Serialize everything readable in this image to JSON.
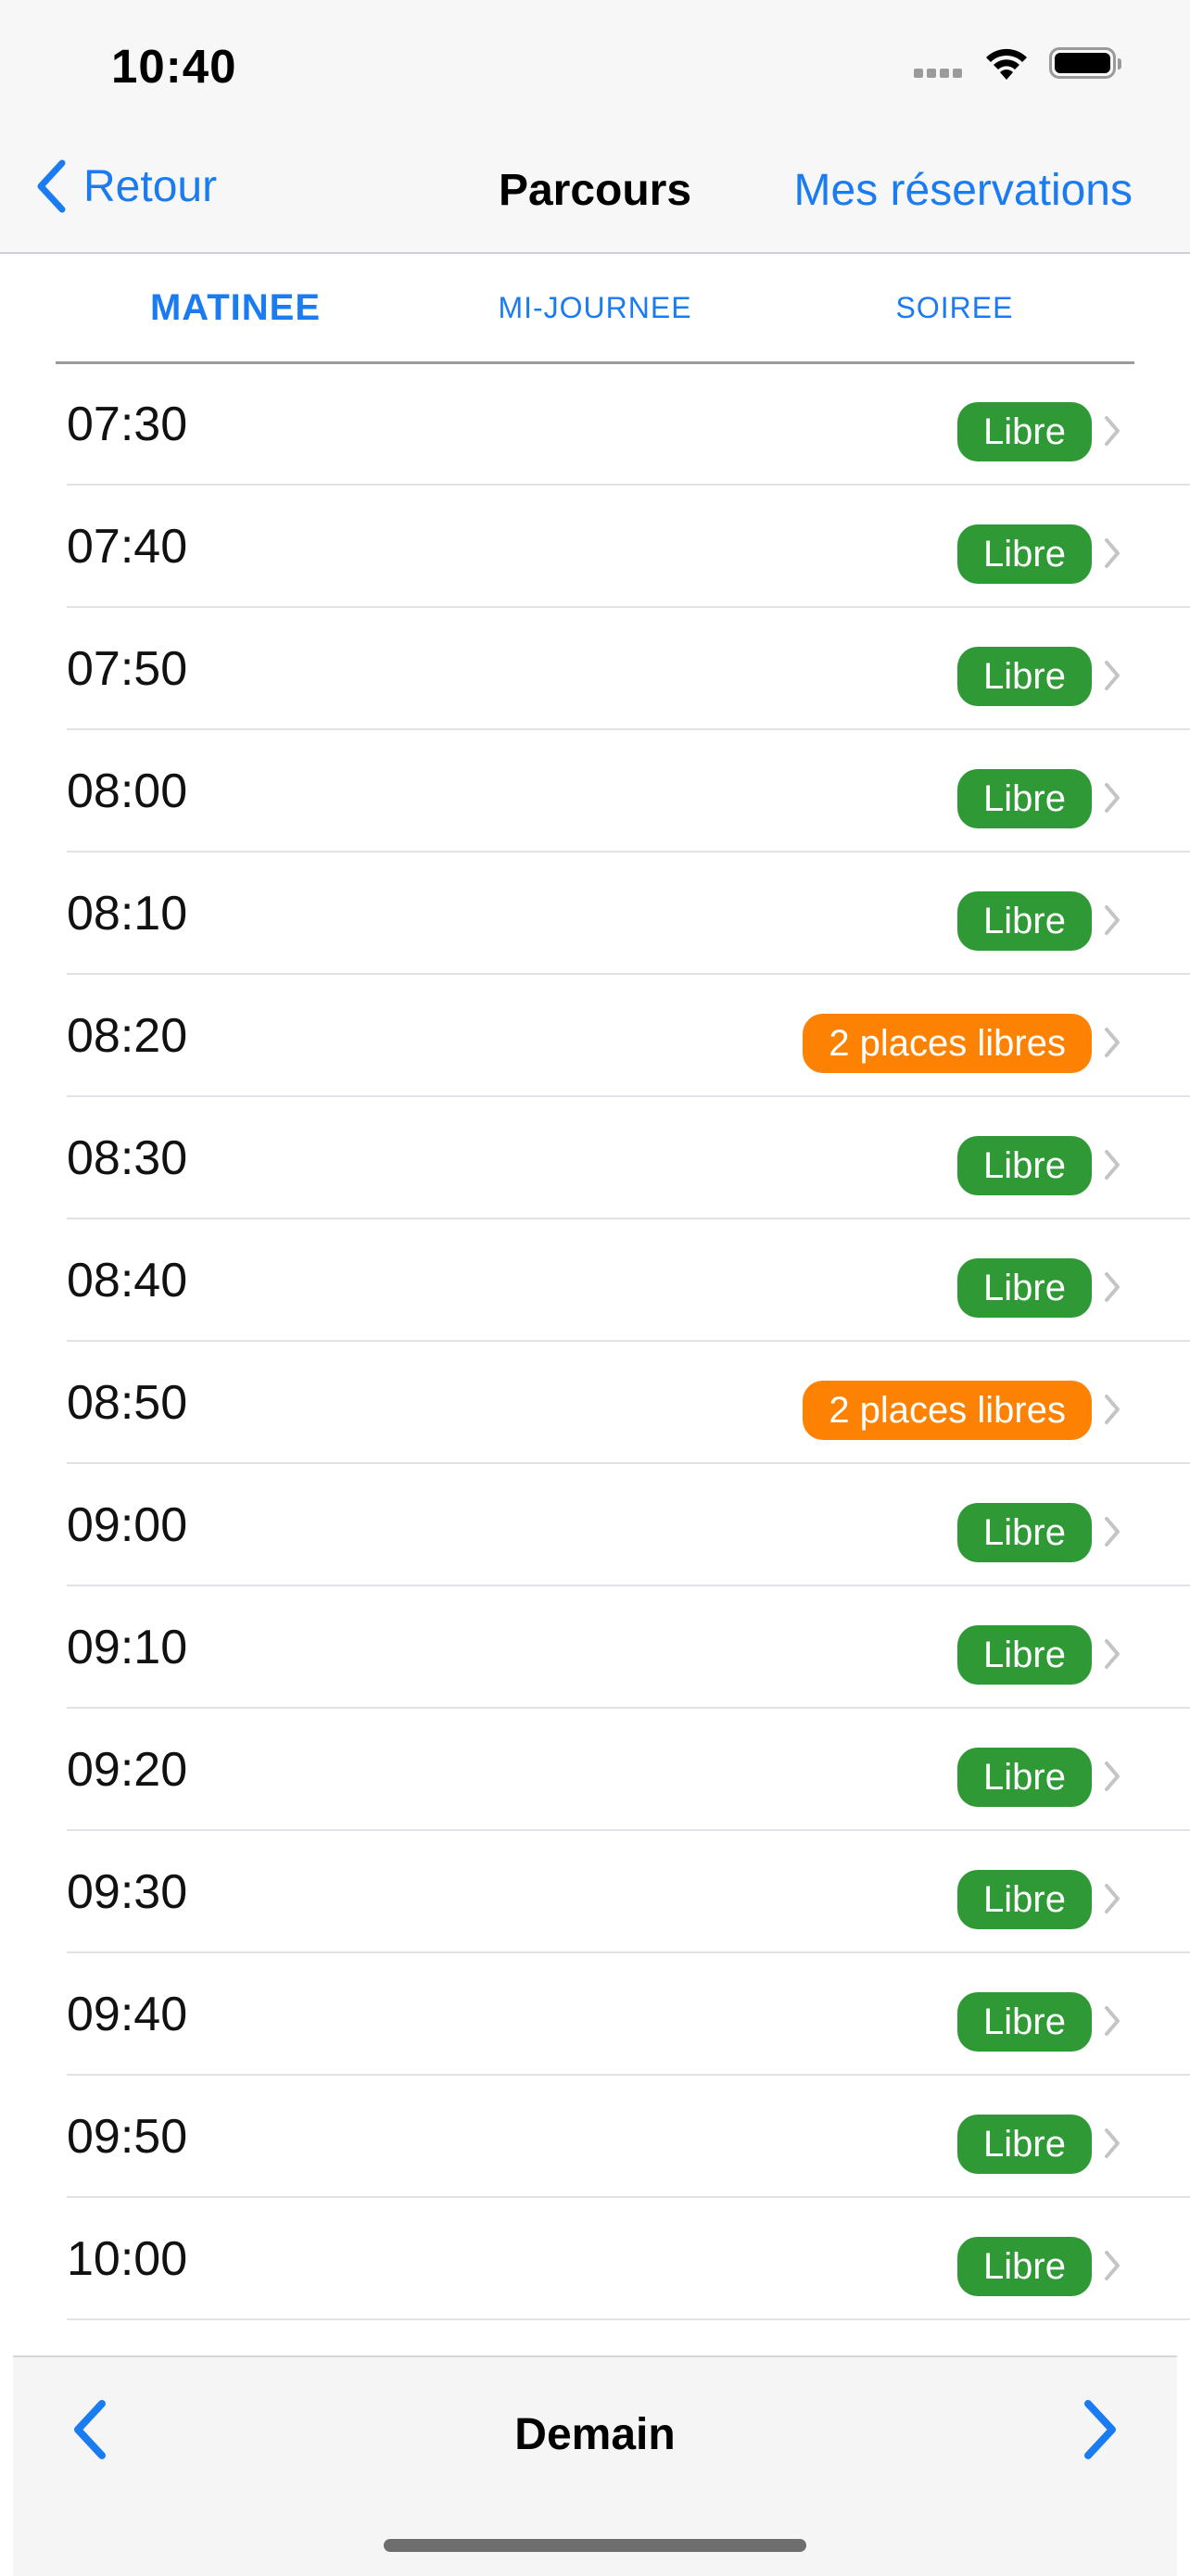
{
  "status_bar": {
    "time": "10:40",
    "icons": [
      "cellular-icon",
      "wifi-icon",
      "battery-icon"
    ]
  },
  "nav": {
    "back_label": "Retour",
    "title": "Parcours",
    "right_label": "Mes réservations"
  },
  "tabs": [
    {
      "label": "MATINEE",
      "active": true
    },
    {
      "label": "MI-JOURNEE",
      "active": false
    },
    {
      "label": "SOIREE",
      "active": false
    }
  ],
  "slots": [
    {
      "time": "07:30",
      "status": "Libre",
      "type": "green"
    },
    {
      "time": "07:40",
      "status": "Libre",
      "type": "green"
    },
    {
      "time": "07:50",
      "status": "Libre",
      "type": "green"
    },
    {
      "time": "08:00",
      "status": "Libre",
      "type": "green"
    },
    {
      "time": "08:10",
      "status": "Libre",
      "type": "green"
    },
    {
      "time": "08:20",
      "status": "2 places libres",
      "type": "orange"
    },
    {
      "time": "08:30",
      "status": "Libre",
      "type": "green"
    },
    {
      "time": "08:40",
      "status": "Libre",
      "type": "green"
    },
    {
      "time": "08:50",
      "status": "2 places libres",
      "type": "orange"
    },
    {
      "time": "09:00",
      "status": "Libre",
      "type": "green"
    },
    {
      "time": "09:10",
      "status": "Libre",
      "type": "green"
    },
    {
      "time": "09:20",
      "status": "Libre",
      "type": "green"
    },
    {
      "time": "09:30",
      "status": "Libre",
      "type": "green"
    },
    {
      "time": "09:40",
      "status": "Libre",
      "type": "green"
    },
    {
      "time": "09:50",
      "status": "Libre",
      "type": "green"
    },
    {
      "time": "10:00",
      "status": "Libre",
      "type": "green"
    }
  ],
  "bottom": {
    "day_label": "Demain"
  },
  "colors": {
    "accent": "#1a7cf0",
    "available": "#2f9a35",
    "limited": "#fd8204"
  }
}
